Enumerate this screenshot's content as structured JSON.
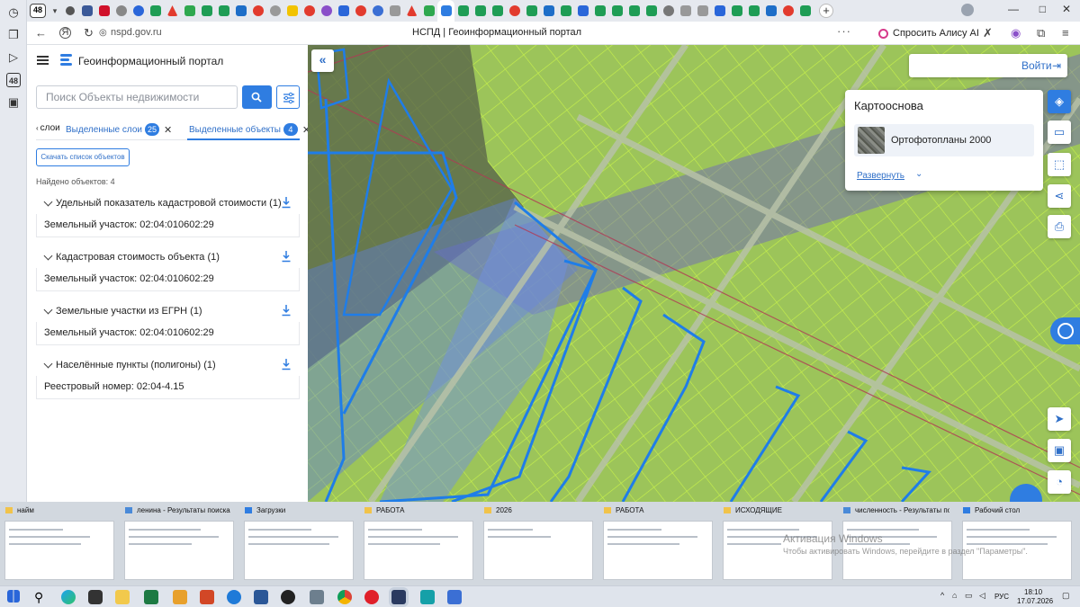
{
  "browser": {
    "tab_count": "48",
    "url": "nspd.gov.ru",
    "page_title": "НСПД | Геоинформационный портал",
    "alisa_button": "Спросить Алису AI"
  },
  "sidebar": {
    "portal_title": "Геоинформационный портал",
    "search_placeholder": "Поиск Объекты недвижимости",
    "tabs": [
      {
        "label": "слои"
      },
      {
        "label": "Выделенные слои",
        "badge": "25"
      },
      {
        "label": "Выделенные объекты",
        "badge": "4"
      }
    ],
    "download_list_button": "Скачать список объектов",
    "found_count": "Найдено объектов: 4",
    "groups": [
      {
        "title": "Удельный показатель кадастровой стоимости (1)",
        "item": "Земельный участок: 02:04:010602:29"
      },
      {
        "title": "Кадастровая стоимость объекта (1)",
        "item": "Земельный участок: 02:04:010602:29"
      },
      {
        "title": "Земельные участки из ЕГРН (1)",
        "item": "Земельный участок: 02:04:010602:29"
      },
      {
        "title": "Населённые пункты (полигоны) (1)",
        "item": "Реестровый номер: 02:04-4.15"
      }
    ]
  },
  "map": {
    "login_label": "Войти",
    "basemap": {
      "title": "Картооснова",
      "item_label": "Ортофотопланы 2000",
      "expand_label": "Развернуть"
    }
  },
  "thumbnails": [
    {
      "title": "найм"
    },
    {
      "title": "ленина - Результаты поиска ..."
    },
    {
      "title": "Загрузки"
    },
    {
      "title": "РАБОТА"
    },
    {
      "title": "2026"
    },
    {
      "title": "РАБОТА"
    },
    {
      "title": "ИСХОДЯЩИЕ"
    },
    {
      "title": "численность - Результаты по..."
    },
    {
      "title": "Рабочий стол"
    }
  ],
  "watermark": {
    "line1": "Активация Windows",
    "line2": "Чтобы активировать Windows, перейдите в раздел \"Параметры\"."
  },
  "taskbar": {
    "time": "18:10",
    "date": "17.07.2026",
    "language": "РУС"
  },
  "colors": {
    "accent": "#2f7de1",
    "parcel_fill": "#9fc95a",
    "parcel_border": "#1f7de8",
    "green_lines": "#c8f24a"
  }
}
